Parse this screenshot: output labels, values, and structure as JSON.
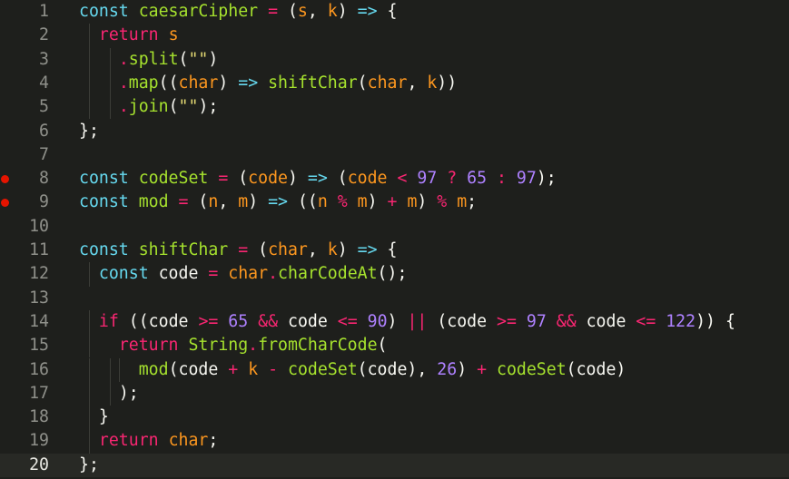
{
  "editor": {
    "current_line": 20,
    "breakpoint_lines": [
      8,
      9
    ],
    "lines": [
      {
        "n": 1,
        "tokens": [
          [
            "const",
            "kw"
          ],
          [
            " ",
            ""
          ],
          [
            "caesarCipher",
            "fn"
          ],
          [
            " ",
            ""
          ],
          [
            "=",
            "op"
          ],
          [
            " ",
            ""
          ],
          [
            "(",
            "b1"
          ],
          [
            "s",
            "prm"
          ],
          [
            ", ",
            "id"
          ],
          [
            "k",
            "prm"
          ],
          [
            ")",
            "b1"
          ],
          [
            " ",
            ""
          ],
          [
            "=>",
            "kw"
          ],
          [
            " ",
            ""
          ],
          [
            "{",
            "b1"
          ]
        ]
      },
      {
        "n": 2,
        "tokens": [
          [
            "  ",
            ""
          ],
          [
            "return",
            "ctl"
          ],
          [
            " ",
            ""
          ],
          [
            "s",
            "prm"
          ]
        ]
      },
      {
        "n": 3,
        "tokens": [
          [
            "    ",
            ""
          ],
          [
            ".",
            "op"
          ],
          [
            "split",
            "fn"
          ],
          [
            "(",
            "b2"
          ],
          [
            "\"\"",
            "str"
          ],
          [
            ")",
            "b2"
          ]
        ]
      },
      {
        "n": 4,
        "tokens": [
          [
            "    ",
            ""
          ],
          [
            ".",
            "op"
          ],
          [
            "map",
            "fn"
          ],
          [
            "(",
            "b2"
          ],
          [
            "(",
            "b3"
          ],
          [
            "char",
            "prm"
          ],
          [
            ")",
            "b3"
          ],
          [
            " ",
            ""
          ],
          [
            "=>",
            "kw"
          ],
          [
            " ",
            ""
          ],
          [
            "shiftChar",
            "fn"
          ],
          [
            "(",
            "b3"
          ],
          [
            "char",
            "prm"
          ],
          [
            ", ",
            "id"
          ],
          [
            "k",
            "prm"
          ],
          [
            ")",
            "b3"
          ],
          [
            ")",
            "b2"
          ]
        ]
      },
      {
        "n": 5,
        "tokens": [
          [
            "    ",
            ""
          ],
          [
            ".",
            "op"
          ],
          [
            "join",
            "fn"
          ],
          [
            "(",
            "b2"
          ],
          [
            "\"\"",
            "str"
          ],
          [
            ")",
            "b2"
          ],
          [
            ";",
            "id"
          ]
        ]
      },
      {
        "n": 6,
        "tokens": [
          [
            "}",
            "b1"
          ],
          [
            ";",
            "id"
          ]
        ]
      },
      {
        "n": 7,
        "tokens": []
      },
      {
        "n": 8,
        "tokens": [
          [
            "const",
            "kw"
          ],
          [
            " ",
            ""
          ],
          [
            "codeSet",
            "fn"
          ],
          [
            " ",
            ""
          ],
          [
            "=",
            "op"
          ],
          [
            " ",
            ""
          ],
          [
            "(",
            "b1"
          ],
          [
            "code",
            "prm"
          ],
          [
            ")",
            "b1"
          ],
          [
            " ",
            ""
          ],
          [
            "=>",
            "kw"
          ],
          [
            " ",
            ""
          ],
          [
            "(",
            "b1"
          ],
          [
            "code",
            "prm"
          ],
          [
            " ",
            ""
          ],
          [
            "<",
            "op"
          ],
          [
            " ",
            ""
          ],
          [
            "97",
            "num"
          ],
          [
            " ",
            ""
          ],
          [
            "?",
            "op"
          ],
          [
            " ",
            ""
          ],
          [
            "65",
            "num"
          ],
          [
            " ",
            ""
          ],
          [
            ":",
            "op"
          ],
          [
            " ",
            ""
          ],
          [
            "97",
            "num"
          ],
          [
            ")",
            "b1"
          ],
          [
            ";",
            "id"
          ]
        ]
      },
      {
        "n": 9,
        "tokens": [
          [
            "const",
            "kw"
          ],
          [
            " ",
            ""
          ],
          [
            "mod",
            "fn"
          ],
          [
            " ",
            ""
          ],
          [
            "=",
            "op"
          ],
          [
            " ",
            ""
          ],
          [
            "(",
            "b1"
          ],
          [
            "n",
            "prm"
          ],
          [
            ", ",
            "id"
          ],
          [
            "m",
            "prm"
          ],
          [
            ")",
            "b1"
          ],
          [
            " ",
            ""
          ],
          [
            "=>",
            "kw"
          ],
          [
            " ",
            ""
          ],
          [
            "(",
            "b1"
          ],
          [
            "(",
            "b2"
          ],
          [
            "n",
            "prm"
          ],
          [
            " ",
            ""
          ],
          [
            "%",
            "op"
          ],
          [
            " ",
            ""
          ],
          [
            "m",
            "prm"
          ],
          [
            ")",
            "b2"
          ],
          [
            " ",
            ""
          ],
          [
            "+",
            "op"
          ],
          [
            " ",
            ""
          ],
          [
            "m",
            "prm"
          ],
          [
            ")",
            "b1"
          ],
          [
            " ",
            ""
          ],
          [
            "%",
            "op"
          ],
          [
            " ",
            ""
          ],
          [
            "m",
            "prm"
          ],
          [
            ";",
            "id"
          ]
        ]
      },
      {
        "n": 10,
        "tokens": []
      },
      {
        "n": 11,
        "tokens": [
          [
            "const",
            "kw"
          ],
          [
            " ",
            ""
          ],
          [
            "shiftChar",
            "fn"
          ],
          [
            " ",
            ""
          ],
          [
            "=",
            "op"
          ],
          [
            " ",
            ""
          ],
          [
            "(",
            "b1"
          ],
          [
            "char",
            "prm"
          ],
          [
            ", ",
            "id"
          ],
          [
            "k",
            "prm"
          ],
          [
            ")",
            "b1"
          ],
          [
            " ",
            ""
          ],
          [
            "=>",
            "kw"
          ],
          [
            " ",
            ""
          ],
          [
            "{",
            "b1"
          ]
        ]
      },
      {
        "n": 12,
        "tokens": [
          [
            "  ",
            ""
          ],
          [
            "const",
            "kw"
          ],
          [
            " ",
            ""
          ],
          [
            "code",
            "id"
          ],
          [
            " ",
            ""
          ],
          [
            "=",
            "op"
          ],
          [
            " ",
            ""
          ],
          [
            "char",
            "prm"
          ],
          [
            ".",
            "op"
          ],
          [
            "charCodeAt",
            "fn"
          ],
          [
            "(",
            "b2"
          ],
          [
            ")",
            "b2"
          ],
          [
            ";",
            "id"
          ]
        ]
      },
      {
        "n": 13,
        "tokens": []
      },
      {
        "n": 14,
        "tokens": [
          [
            "  ",
            ""
          ],
          [
            "if",
            "ctl"
          ],
          [
            " ",
            ""
          ],
          [
            "(",
            "b2"
          ],
          [
            "(",
            "b3"
          ],
          [
            "code",
            "id"
          ],
          [
            " ",
            ""
          ],
          [
            ">=",
            "op"
          ],
          [
            " ",
            ""
          ],
          [
            "65",
            "num"
          ],
          [
            " ",
            ""
          ],
          [
            "&&",
            "op"
          ],
          [
            " ",
            ""
          ],
          [
            "code",
            "id"
          ],
          [
            " ",
            ""
          ],
          [
            "<=",
            "op"
          ],
          [
            " ",
            ""
          ],
          [
            "90",
            "num"
          ],
          [
            ")",
            "b3"
          ],
          [
            " ",
            ""
          ],
          [
            "||",
            "op"
          ],
          [
            " ",
            ""
          ],
          [
            "(",
            "b3"
          ],
          [
            "code",
            "id"
          ],
          [
            " ",
            ""
          ],
          [
            ">=",
            "op"
          ],
          [
            " ",
            ""
          ],
          [
            "97",
            "num"
          ],
          [
            " ",
            ""
          ],
          [
            "&&",
            "op"
          ],
          [
            " ",
            ""
          ],
          [
            "code",
            "id"
          ],
          [
            " ",
            ""
          ],
          [
            "<=",
            "op"
          ],
          [
            " ",
            ""
          ],
          [
            "122",
            "num"
          ],
          [
            ")",
            "b3"
          ],
          [
            ")",
            "b2"
          ],
          [
            " ",
            ""
          ],
          [
            "{",
            "b2"
          ]
        ]
      },
      {
        "n": 15,
        "tokens": [
          [
            "    ",
            ""
          ],
          [
            "return",
            "ctl"
          ],
          [
            " ",
            ""
          ],
          [
            "String",
            "cls"
          ],
          [
            ".",
            "op"
          ],
          [
            "fromCharCode",
            "fn"
          ],
          [
            "(",
            "b3"
          ]
        ]
      },
      {
        "n": 16,
        "tokens": [
          [
            "      ",
            ""
          ],
          [
            "mod",
            "fn"
          ],
          [
            "(",
            "b1"
          ],
          [
            "code",
            "id"
          ],
          [
            " ",
            ""
          ],
          [
            "+",
            "op"
          ],
          [
            " ",
            ""
          ],
          [
            "k",
            "prm"
          ],
          [
            " ",
            ""
          ],
          [
            "-",
            "op"
          ],
          [
            " ",
            ""
          ],
          [
            "codeSet",
            "fn"
          ],
          [
            "(",
            "b2"
          ],
          [
            "code",
            "id"
          ],
          [
            ")",
            "b2"
          ],
          [
            ", ",
            "id"
          ],
          [
            "26",
            "num"
          ],
          [
            ")",
            "b1"
          ],
          [
            " ",
            ""
          ],
          [
            "+",
            "op"
          ],
          [
            " ",
            ""
          ],
          [
            "codeSet",
            "fn"
          ],
          [
            "(",
            "b1"
          ],
          [
            "code",
            "id"
          ],
          [
            ")",
            "b1"
          ]
        ]
      },
      {
        "n": 17,
        "tokens": [
          [
            "    ",
            ""
          ],
          [
            ")",
            "b3"
          ],
          [
            ";",
            "id"
          ]
        ]
      },
      {
        "n": 18,
        "tokens": [
          [
            "  ",
            ""
          ],
          [
            "}",
            "b2"
          ]
        ]
      },
      {
        "n": 19,
        "tokens": [
          [
            "  ",
            ""
          ],
          [
            "return",
            "ctl"
          ],
          [
            " ",
            ""
          ],
          [
            "char",
            "prm"
          ],
          [
            ";",
            "id"
          ]
        ]
      },
      {
        "n": 20,
        "tokens": [
          [
            "}",
            "b1"
          ],
          [
            ";",
            "id"
          ]
        ]
      }
    ]
  },
  "colors": {
    "background": "#1e1f1c",
    "current_line": "#282925",
    "breakpoint": "#e51400",
    "keyword": "#66d9ef",
    "control": "#f92672",
    "function": "#a6e22e",
    "parameter": "#fd971f",
    "number": "#ae81ff",
    "string": "#e6db74"
  }
}
